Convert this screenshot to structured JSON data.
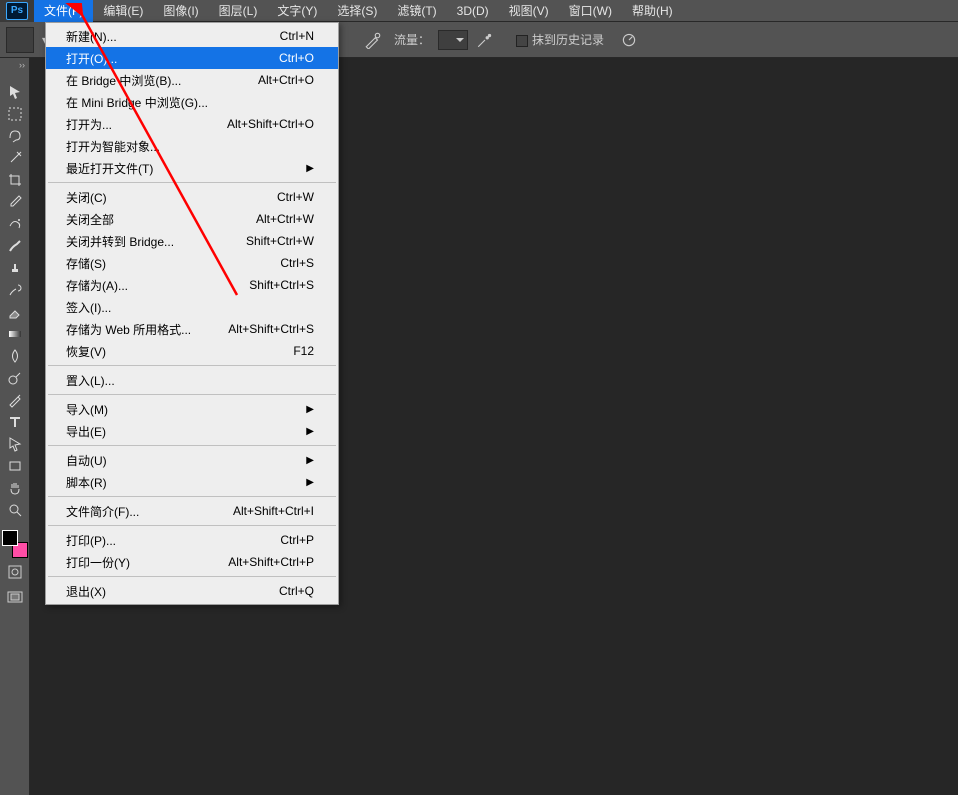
{
  "app": {
    "badge": "Ps"
  },
  "menubar": [
    {
      "label": "文件(F)",
      "open": true
    },
    {
      "label": "编辑(E)"
    },
    {
      "label": "图像(I)"
    },
    {
      "label": "图层(L)"
    },
    {
      "label": "文字(Y)"
    },
    {
      "label": "选择(S)"
    },
    {
      "label": "滤镜(T)"
    },
    {
      "label": "3D(D)"
    },
    {
      "label": "视图(V)"
    },
    {
      "label": "窗口(W)"
    },
    {
      "label": "帮助(H)"
    }
  ],
  "optionsbar": {
    "flow_label": "流量：",
    "history_label": "抹到历史记录"
  },
  "dropdown": {
    "groups": [
      [
        {
          "label": "新建(N)...",
          "shortcut": "Ctrl+N"
        },
        {
          "label": "打开(O)...",
          "shortcut": "Ctrl+O",
          "highlight": true
        },
        {
          "label": "在 Bridge 中浏览(B)...",
          "shortcut": "Alt+Ctrl+O"
        },
        {
          "label": "在 Mini Bridge 中浏览(G)..."
        },
        {
          "label": "打开为...",
          "shortcut": "Alt+Shift+Ctrl+O"
        },
        {
          "label": "打开为智能对象..."
        },
        {
          "label": "最近打开文件(T)",
          "submenu": true
        }
      ],
      [
        {
          "label": "关闭(C)",
          "shortcut": "Ctrl+W"
        },
        {
          "label": "关闭全部",
          "shortcut": "Alt+Ctrl+W"
        },
        {
          "label": "关闭并转到 Bridge...",
          "shortcut": "Shift+Ctrl+W"
        },
        {
          "label": "存储(S)",
          "shortcut": "Ctrl+S"
        },
        {
          "label": "存储为(A)...",
          "shortcut": "Shift+Ctrl+S"
        },
        {
          "label": "签入(I)..."
        },
        {
          "label": "存储为 Web 所用格式...",
          "shortcut": "Alt+Shift+Ctrl+S"
        },
        {
          "label": "恢复(V)",
          "shortcut": "F12"
        }
      ],
      [
        {
          "label": "置入(L)..."
        }
      ],
      [
        {
          "label": "导入(M)",
          "submenu": true
        },
        {
          "label": "导出(E)",
          "submenu": true
        }
      ],
      [
        {
          "label": "自动(U)",
          "submenu": true
        },
        {
          "label": "脚本(R)",
          "submenu": true
        }
      ],
      [
        {
          "label": "文件简介(F)...",
          "shortcut": "Alt+Shift+Ctrl+I"
        }
      ],
      [
        {
          "label": "打印(P)...",
          "shortcut": "Ctrl+P"
        },
        {
          "label": "打印一份(Y)",
          "shortcut": "Alt+Shift+Ctrl+P"
        }
      ],
      [
        {
          "label": "退出(X)",
          "shortcut": "Ctrl+Q"
        }
      ]
    ]
  },
  "tools": [
    "move",
    "marquee",
    "lasso",
    "magic-wand",
    "crop",
    "eyedropper",
    "healing",
    "brush",
    "stamp",
    "history-brush",
    "eraser",
    "gradient",
    "blur",
    "dodge",
    "pen",
    "type",
    "path-select",
    "rectangle",
    "hand",
    "zoom"
  ],
  "swatches": {
    "front": "#000000",
    "back": "#ff4da6"
  }
}
